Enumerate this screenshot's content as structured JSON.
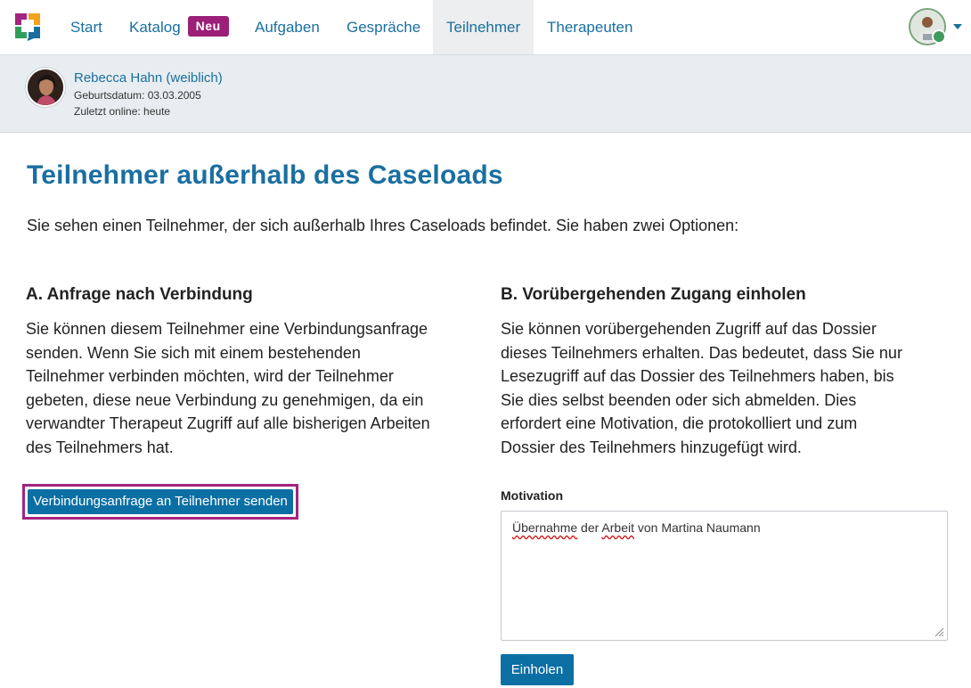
{
  "nav": {
    "items": [
      {
        "label": "Start"
      },
      {
        "label": "Katalog",
        "badge": "Neu"
      },
      {
        "label": "Aufgaben"
      },
      {
        "label": "Gespräche"
      },
      {
        "label": "Teilnehmer",
        "active": true
      },
      {
        "label": "Therapeuten"
      }
    ]
  },
  "participant": {
    "name": "Rebecca Hahn (weiblich)",
    "birthdate": "Geburtsdatum: 03.03.2005",
    "last_online": "Zuletzt online: heute"
  },
  "page": {
    "title": "Teilnehmer außerhalb des Caseloads",
    "intro": "Sie sehen einen Teilnehmer, der sich außerhalb Ihres Caseloads befindet. Sie haben zwei Optionen:"
  },
  "option_a": {
    "title": "A. Anfrage nach Verbindung",
    "lines": [
      "Sie können diesem Teilnehmer eine Verbindungsanfrage",
      "senden. Wenn Sie sich mit einem bestehenden",
      "Teilnehmer verbinden möchten, wird der Teilnehmer",
      "gebeten, diese neue Verbindung zu genehmigen, da ein",
      "verwandter Therapeut Zugriff auf alle bisherigen Arbeiten",
      "des Teilnehmers hat."
    ],
    "button_label": "Verbindungsanfrage an Teilnehmer senden"
  },
  "option_b": {
    "title": "B. Vorübergehenden Zugang einholen",
    "lines": [
      "Sie können vorübergehenden Zugriff auf das Dossier",
      "dieses Teilnehmers erhalten. Das bedeutet, dass Sie nur",
      "Lesezugriff auf das Dossier des Teilnehmers haben, bis",
      "Sie dies selbst beenden oder sich abmelden. Dies",
      "erfordert eine Motivation, die protokolliert und zum",
      "Dossier des Teilnehmers hinzugefügt wird."
    ],
    "motivation_label": "Motivation",
    "motivation_parts": [
      "Übernahme",
      " der ",
      "Arbeit",
      " von Martina Naumann"
    ],
    "button_label": "Einholen"
  },
  "colors": {
    "brand_blue": "#1a6fa0",
    "button_blue": "#0b6fa4",
    "highlight_magenta": "#a3247f",
    "badge_purple": "#9c1f78"
  },
  "icons": [
    "app-logo-icon",
    "user-avatar",
    "chevron-down-icon",
    "online-status-icon",
    "resize-handle-icon"
  ]
}
